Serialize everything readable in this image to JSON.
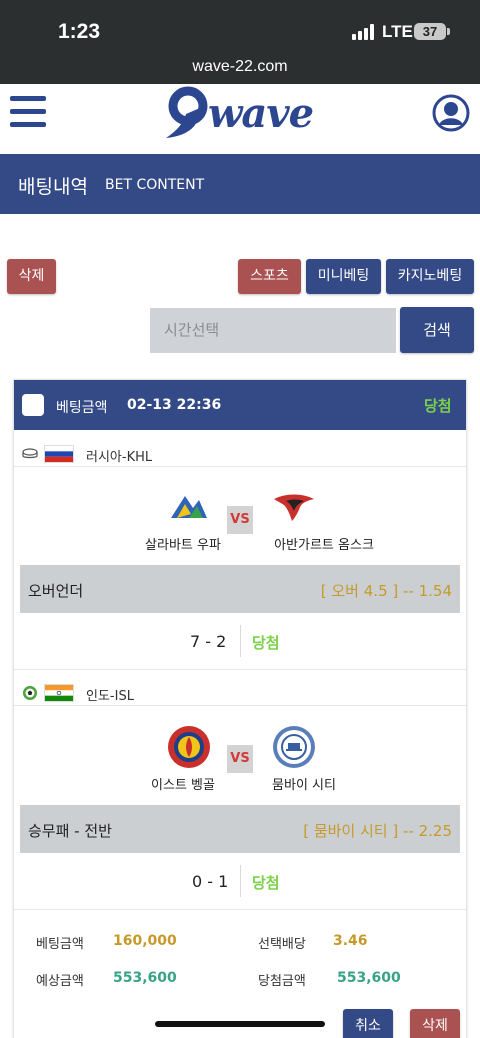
{
  "status_bar": {
    "time": "1:23",
    "network": "LTE",
    "battery": "37"
  },
  "browser": {
    "url": "wave-22.com"
  },
  "header": {
    "logo_text": "wave",
    "colors": {
      "brand": "#2d4690"
    }
  },
  "title": {
    "ko": "배팅내역",
    "en": "BET CONTENT"
  },
  "toolbar": {
    "delete_label": "삭제",
    "tabs": [
      "스포츠",
      "미니베팅",
      "카지노베팅"
    ],
    "search_placeholder": "시간선택",
    "search_label": "검색"
  },
  "bet_card": {
    "header": {
      "label": "베팅금액",
      "date": "02-13 22:36",
      "result": "당첨"
    },
    "matches": [
      {
        "sport_icon": "hockey-puck-icon",
        "flag": "russia-flag",
        "league": "러시아-KHL",
        "home": "살라바트 우파",
        "away": "아반가르트 옴스크",
        "vs": "VS",
        "market": "오버언더",
        "pick": "[ 오버 4.5 ] -- 1.54",
        "score": "7 - 2",
        "result": "당첨"
      },
      {
        "sport_icon": "soccer-ball-icon",
        "flag": "india-flag",
        "league": "인도-ISL",
        "home": "이스트 벵골",
        "away": "뭄바이 시티",
        "vs": "VS",
        "market": "승무패 - 전반",
        "pick": "[ 뭄바이 시티 ] -- 2.25",
        "score": "0 - 1",
        "result": "당첨"
      }
    ],
    "summary": {
      "bet_amount_label": "베팅금액",
      "bet_amount": "160,000",
      "odds_label": "선택배당",
      "odds": "3.46",
      "expected_label": "예상금액",
      "expected": "553,600",
      "win_label": "당첨금액",
      "win": "553,600"
    },
    "actions": {
      "cancel_label": "취소",
      "delete_label": "삭제"
    }
  }
}
